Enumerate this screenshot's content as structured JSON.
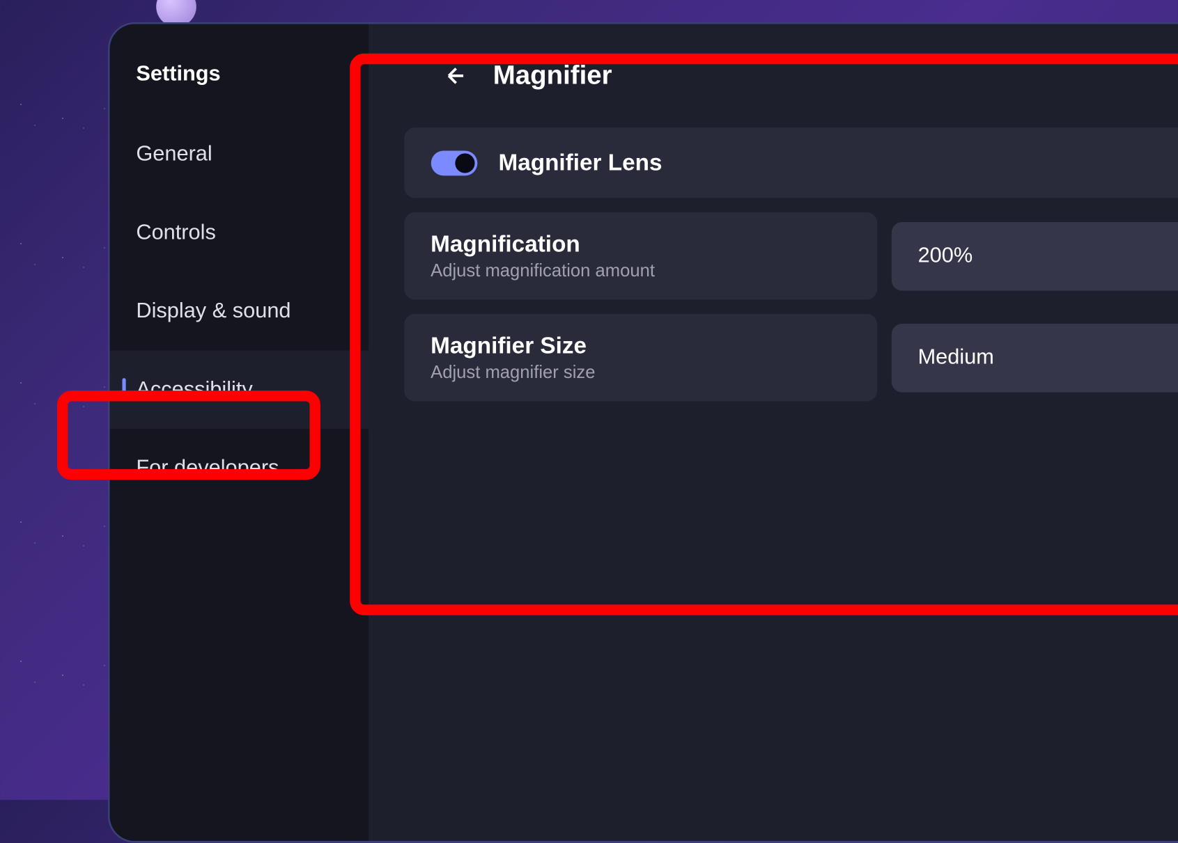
{
  "sidebar": {
    "title": "Settings",
    "items": [
      {
        "label": "General"
      },
      {
        "label": "Controls"
      },
      {
        "label": "Display & sound"
      },
      {
        "label": "Accessibility"
      },
      {
        "label": "For developers"
      }
    ],
    "activeIndex": 3
  },
  "page": {
    "title": "Magnifier"
  },
  "settings": {
    "lens": {
      "label": "Magnifier Lens",
      "enabled": true
    },
    "magnification": {
      "title": "Magnification",
      "subtitle": "Adjust magnification amount",
      "value": "200%"
    },
    "size": {
      "title": "Magnifier Size",
      "subtitle": "Adjust magnifier size",
      "value": "Medium"
    }
  },
  "colors": {
    "accent": "#7b8aff",
    "highlight": "#ff0000"
  }
}
